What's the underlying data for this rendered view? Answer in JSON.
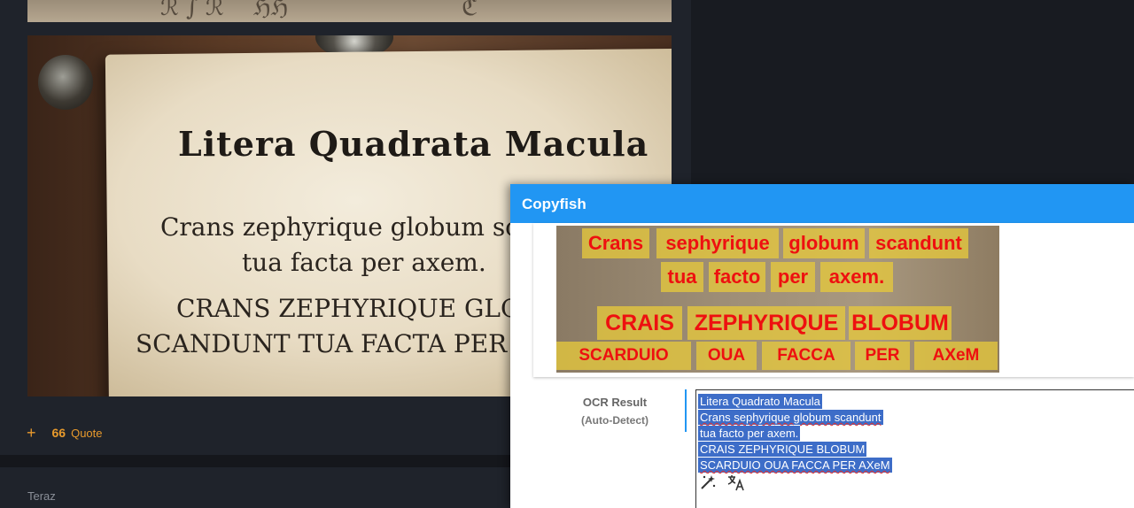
{
  "forum": {
    "paper_title": "Litera Quadrata Macula",
    "paper_lines": [
      "Crans zephyrique globum scand",
      "tua facta per axem.",
      "CRANS ZEPHYRIQUE GLOBU",
      "SCANDUNT TUA FACTA PER A"
    ],
    "actions": {
      "add_label": "+",
      "quote_icon": "66",
      "quote_label": "Quote"
    },
    "next_post_label": "Teraz",
    "accent": "#e89a2c"
  },
  "copyfish": {
    "title": "Copyfish",
    "header_color": "#2196f3",
    "preview_words": [
      {
        "text": "Crans",
        "size": 22
      },
      {
        "text": "sephyrique",
        "size": 22
      },
      {
        "text": "globum",
        "size": 22
      },
      {
        "text": "scandunt",
        "size": 22
      },
      {
        "text": "tua",
        "size": 22
      },
      {
        "text": "facto",
        "size": 22
      },
      {
        "text": "per",
        "size": 22
      },
      {
        "text": "axem.",
        "size": 22
      },
      {
        "text": "CRAIS",
        "size": 25
      },
      {
        "text": "ZEPHYRIQUE",
        "size": 25
      },
      {
        "text": "BLOBUM",
        "size": 25
      },
      {
        "text": "SCARDUIO",
        "size": 19
      },
      {
        "text": "OUA",
        "size": 19
      },
      {
        "text": "FACCA",
        "size": 19
      },
      {
        "text": "PER",
        "size": 19
      },
      {
        "text": "AXeM",
        "size": 19
      }
    ],
    "ocr_label": "OCR Result",
    "ocr_sublabel": "(Auto-Detect)",
    "ocr_lines": [
      "Litera Quadrato Macula",
      "Crans sephyrique globum scandunt",
      "tua facto per axem.",
      "CRAIS ZEPHYRIQUE BLOBUM",
      "SCARDUIO OUA FACCA PER AXeM"
    ],
    "tools": {
      "magic_icon": "magic-wand-icon",
      "translate_icon": "translate-icon"
    }
  }
}
